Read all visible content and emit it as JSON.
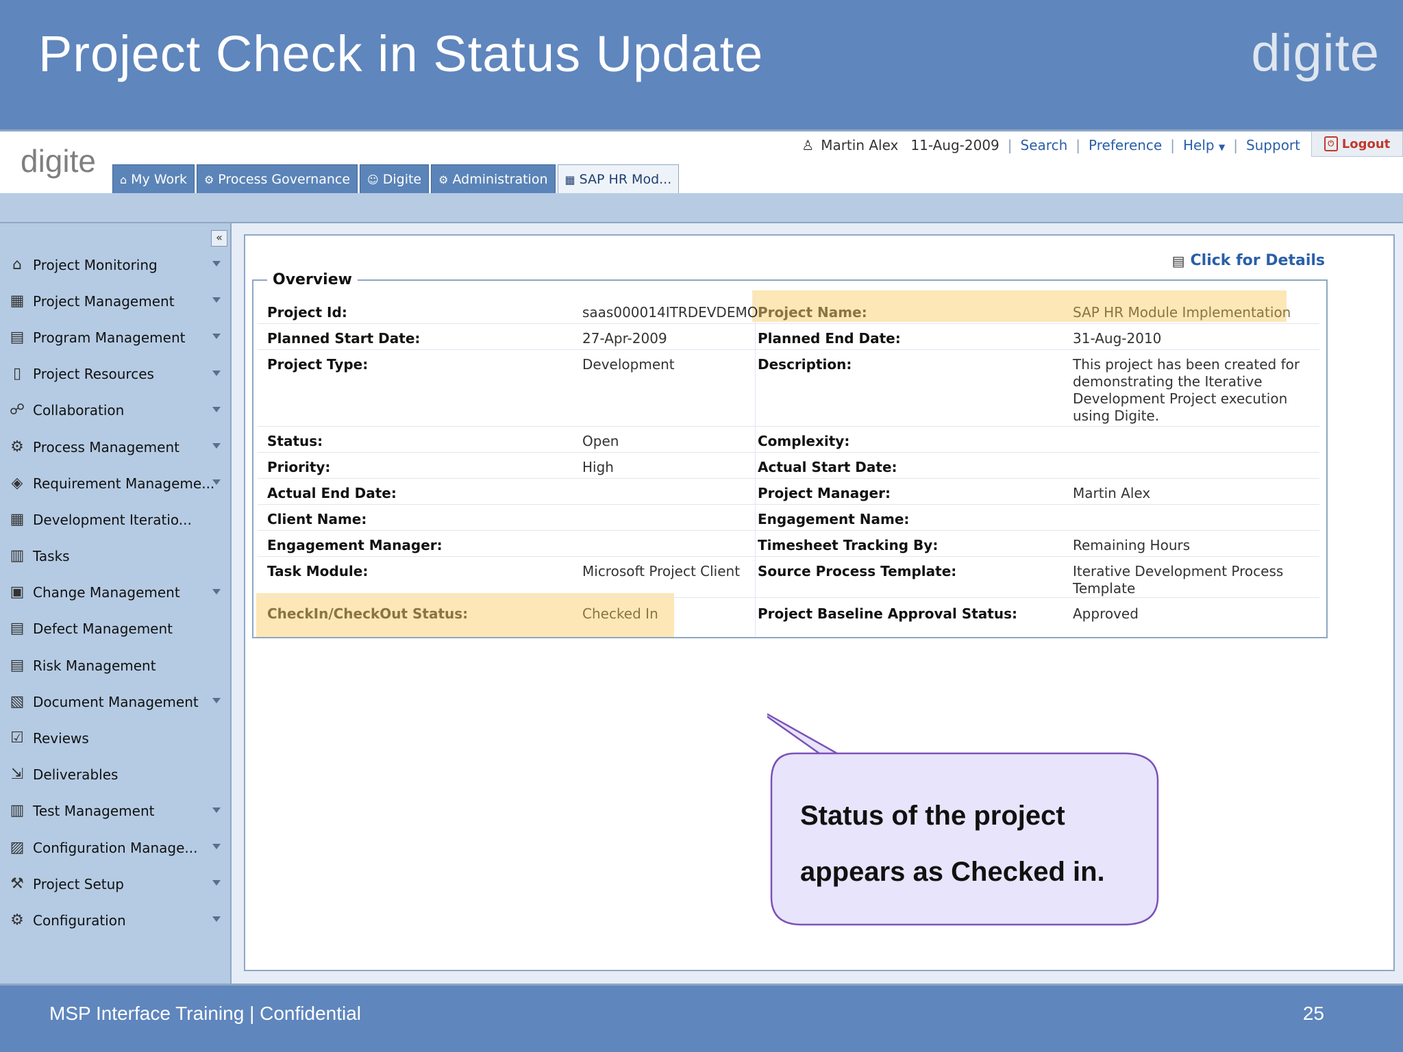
{
  "slide": {
    "title": "Project Check in Status Update",
    "logo": "digite",
    "footer_text": "MSP Interface Training | Confidential",
    "page_number": "25"
  },
  "app": {
    "logo": "digite",
    "topbar": {
      "user": "Martin Alex",
      "date": "11-Aug-2009",
      "search": "Search",
      "preference": "Preference",
      "help": "Help",
      "support": "Support",
      "logout": "Logout"
    },
    "tabs": [
      {
        "label": "My Work",
        "icon": "home-icon"
      },
      {
        "label": "Process Governance",
        "icon": "gear-icon"
      },
      {
        "label": "Digite",
        "icon": "people-icon"
      },
      {
        "label": "Administration",
        "icon": "gear-icon"
      },
      {
        "label": "SAP HR Mod...",
        "icon": "project-icon",
        "active": true
      }
    ]
  },
  "sidebar": {
    "collapse": "«",
    "items": [
      {
        "label": "Project Monitoring",
        "icon": "house-icon",
        "glyph": "⌂",
        "arrow": true
      },
      {
        "label": "Project Management",
        "icon": "project-icon",
        "glyph": "▦",
        "arrow": true
      },
      {
        "label": "Program Management",
        "icon": "program-icon",
        "glyph": "▤",
        "arrow": true
      },
      {
        "label": "Project Resources",
        "icon": "resource-icon",
        "glyph": "▯",
        "arrow": true
      },
      {
        "label": "Collaboration",
        "icon": "collaboration-icon",
        "glyph": "☍",
        "arrow": true
      },
      {
        "label": "Process Management",
        "icon": "process-icon",
        "glyph": "⚙",
        "arrow": true
      },
      {
        "label": "Requirement Manageme...",
        "icon": "requirement-icon",
        "glyph": "◈",
        "arrow": true
      },
      {
        "label": "Development Iteratio...",
        "icon": "calendar-icon",
        "glyph": "▦",
        "arrow": false
      },
      {
        "label": "Tasks",
        "icon": "tasks-icon",
        "glyph": "▥",
        "arrow": false
      },
      {
        "label": "Change Management",
        "icon": "change-icon",
        "glyph": "▣",
        "arrow": true
      },
      {
        "label": "Defect Management",
        "icon": "defect-icon",
        "glyph": "▤",
        "arrow": false
      },
      {
        "label": "Risk Management",
        "icon": "risk-icon",
        "glyph": "▤",
        "arrow": false
      },
      {
        "label": "Document Management",
        "icon": "document-icon",
        "glyph": "▧",
        "arrow": true
      },
      {
        "label": "Reviews",
        "icon": "review-icon",
        "glyph": "☑",
        "arrow": false
      },
      {
        "label": "Deliverables",
        "icon": "deliverables-icon",
        "glyph": "⇲",
        "arrow": false
      },
      {
        "label": "Test Management",
        "icon": "test-icon",
        "glyph": "▥",
        "arrow": true
      },
      {
        "label": "Configuration Manage...",
        "icon": "config-manage-icon",
        "glyph": "▨",
        "arrow": true
      },
      {
        "label": "Project Setup",
        "icon": "setup-icon",
        "glyph": "⚒",
        "arrow": true
      },
      {
        "label": "Configuration",
        "icon": "configuration-icon",
        "glyph": "⚙",
        "arrow": true
      }
    ]
  },
  "details": {
    "link": "Click for Details",
    "section": "Overview",
    "left": [
      {
        "label": "Project Id:",
        "value": "saas000014ITRDEVDEMO"
      },
      {
        "label": "Planned Start Date:",
        "value": "27-Apr-2009"
      },
      {
        "label": "Project Type:",
        "value": "Development"
      },
      {
        "label": "Status:",
        "value": "Open"
      },
      {
        "label": "Priority:",
        "value": "High"
      },
      {
        "label": "Actual End Date:",
        "value": ""
      },
      {
        "label": "Client Name:",
        "value": ""
      },
      {
        "label": "Engagement Manager:",
        "value": ""
      },
      {
        "label": "Task Module:",
        "value": "Microsoft Project Client"
      },
      {
        "label": "CheckIn/CheckOut Status:",
        "value": "Checked In"
      }
    ],
    "right": [
      {
        "label": "Project Name:",
        "value": "SAP HR Module Implementation"
      },
      {
        "label": "Planned End Date:",
        "value": "31-Aug-2010"
      },
      {
        "label": "Description:",
        "value": "This project has been created for demonstrating the Iterative Development Project execution using Digite."
      },
      {
        "label": "Complexity:",
        "value": ""
      },
      {
        "label": "Actual Start Date:",
        "value": ""
      },
      {
        "label": "Project Manager:",
        "value": "Martin Alex"
      },
      {
        "label": "Engagement Name:",
        "value": ""
      },
      {
        "label": "Timesheet Tracking By:",
        "value": "Remaining Hours"
      },
      {
        "label": "Source Process Template:",
        "value": "Iterative Development Process Template"
      },
      {
        "label": "Project Baseline Approval Status:",
        "value": "Approved"
      }
    ]
  },
  "callout": {
    "line1": "Status of the project",
    "line2": "appears as Checked in."
  }
}
